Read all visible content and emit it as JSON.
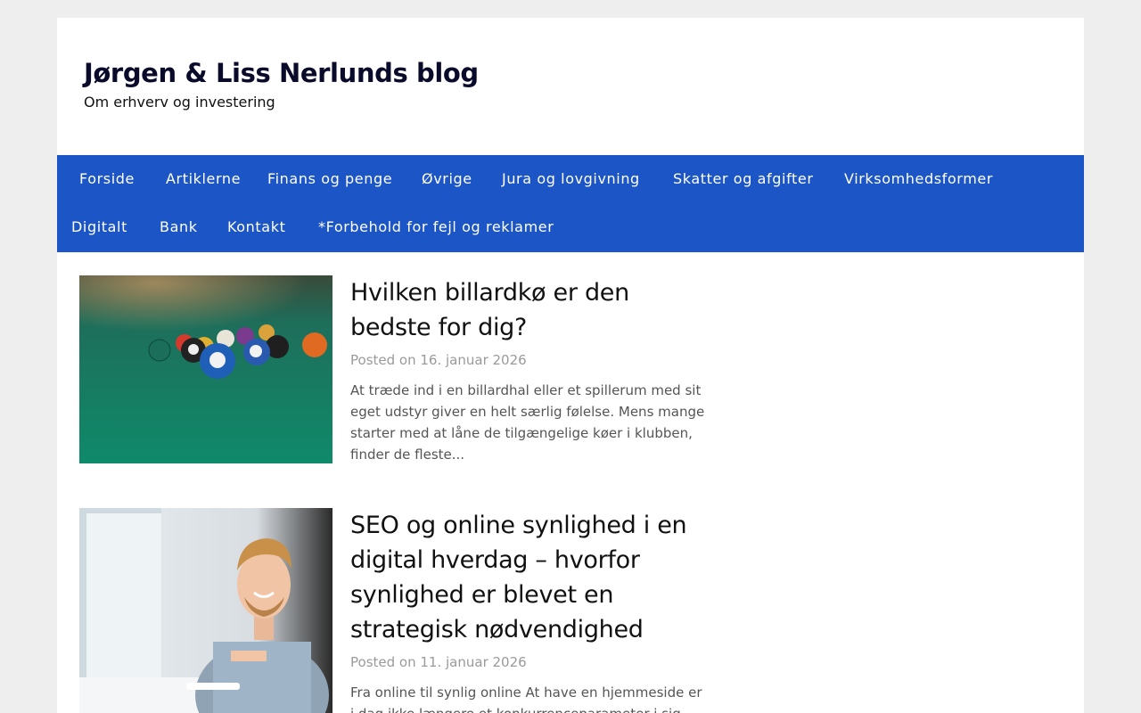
{
  "site": {
    "title": "Jørgen & Liss Nerlunds blog",
    "tagline": "Om erhverv og investering"
  },
  "nav": {
    "row1": [
      "Forside",
      "Artiklerne",
      "Finans og penge",
      "Øvrige",
      "Jura og lovgivning",
      "Skatter og afgifter",
      "Virksomhedsformer"
    ],
    "row2": [
      "Digitalt",
      "Bank",
      "Kontakt",
      "*Forbehold for fejl og reklamer"
    ]
  },
  "posts": [
    {
      "title": "Hvilken billardkø er den bedste for dig?",
      "posted_prefix": "Posted on",
      "date": "16. januar 2026",
      "excerpt": "At træde ind i en billardhal eller et spillerum med sit eget udstyr giver en helt særlig følelse. Mens mange starter med at låne de tilgængelige køer i klubben, finder de fleste..."
    },
    {
      "title": "SEO og online synlighed i en digital hverdag – hvorfor synlighed er blevet en strategisk nødvendighed",
      "posted_prefix": "Posted on",
      "date": "11. januar 2026",
      "excerpt": "Fra online til synlig online At have en hjemmeside er i dag ikke længere et konkurrenceparameter i sig selv..."
    }
  ],
  "colors": {
    "nav_background": "#1c55c6",
    "page_background": "#eeeeee",
    "meta_text": "#9a9a9a"
  }
}
